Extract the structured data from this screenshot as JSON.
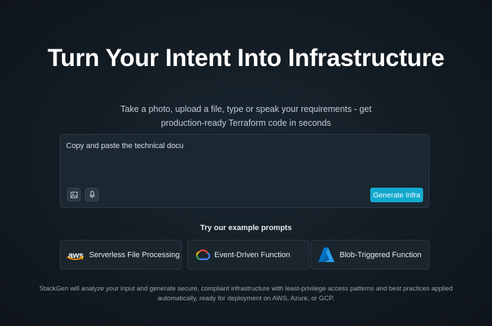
{
  "hero": {
    "title": "Turn Your Intent Into Infrastructure",
    "subtitle_line1": "Take a photo, upload a file, type or speak your requirements - get",
    "subtitle_line2": "production-ready Terraform code in seconds"
  },
  "prompt": {
    "value": "Copy and paste the technical docu",
    "placeholder": "",
    "image_icon": "image-icon",
    "mic_icon": "microphone-icon",
    "generate_label": "Generate Infra"
  },
  "examples": {
    "heading": "Try our example prompts",
    "items": [
      {
        "provider_icon": "aws-logo-icon",
        "logo_text": "aws",
        "label": "Serverless File Processing"
      },
      {
        "provider_icon": "google-cloud-icon",
        "label": "Event-Driven Function"
      },
      {
        "provider_icon": "azure-icon",
        "label": "Blob-Triggered Function"
      }
    ]
  },
  "footer": {
    "line1": "StackGen will analyze your input and generate secure, compliant infrastructure with least-privilege access patterns and best practices applied",
    "line2": "automatically, ready for deployment on AWS, Azure, or GCP."
  },
  "colors": {
    "accent": "#12a9cf",
    "background": "#141d25",
    "card": "#1a252e",
    "aws_orange": "#ff9900",
    "gcp_blue": "#4285f4",
    "gcp_red": "#ea4335",
    "gcp_yellow": "#fbbc05",
    "gcp_green": "#34a853",
    "azure_blue": "#0089d6"
  }
}
